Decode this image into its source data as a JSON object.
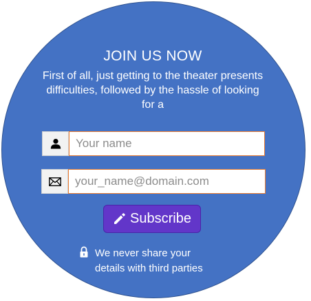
{
  "header": {
    "title": "JOIN US NOW",
    "description": "First of all, just getting to the theater presents difficulties, followed by the hassle of looking for a"
  },
  "form": {
    "name_field": {
      "icon": "person-icon",
      "placeholder": "Your name",
      "value": ""
    },
    "email_field": {
      "icon": "envelope-icon",
      "placeholder": "your_name@domain.com",
      "value": ""
    },
    "subscribe_button": {
      "icon": "pencil-icon",
      "label": "Subscribe"
    }
  },
  "privacy_note": {
    "icon": "lock-icon",
    "line1": "We never share your",
    "line2": "details with third parties"
  },
  "colors": {
    "circle_fill": "#4472c4",
    "input_border": "#ed7d31",
    "button_fill": "#6236c9",
    "text": "#ffffff"
  }
}
